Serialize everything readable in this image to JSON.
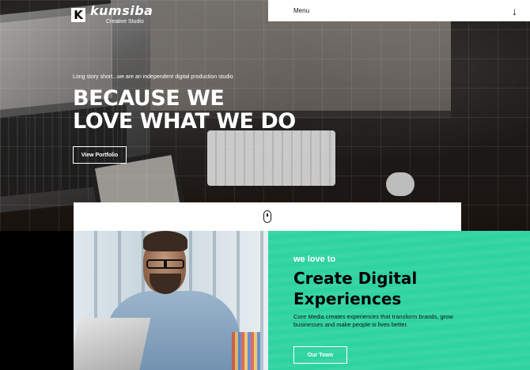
{
  "brand": {
    "logo_letter": "K",
    "name": "kumsiba",
    "subtitle": "Creative Studio"
  },
  "nav": {
    "menu_label": "Menu",
    "menu_icon": "arrow-down-icon"
  },
  "hero": {
    "tagline": "Long story short...we are an independent digital production studio",
    "headline_line1": "BECAUSE WE",
    "headline_line2": "LOVE WHAT WE DO",
    "button_label": "View Portfolio"
  },
  "scroll": {
    "icon": "mouse-scroll-icon"
  },
  "feature": {
    "eyebrow": "we love to",
    "title_line1": "Create Digital",
    "title_line2": "Experiences",
    "description": "Core Media creates experiences that transform brands, grow businesses and make people is lives better.",
    "button_label": "Our Team"
  },
  "colors": {
    "accent_green": "#2ed3a0",
    "hero_overlay": "#2a2522",
    "white": "#ffffff",
    "black": "#000000"
  }
}
